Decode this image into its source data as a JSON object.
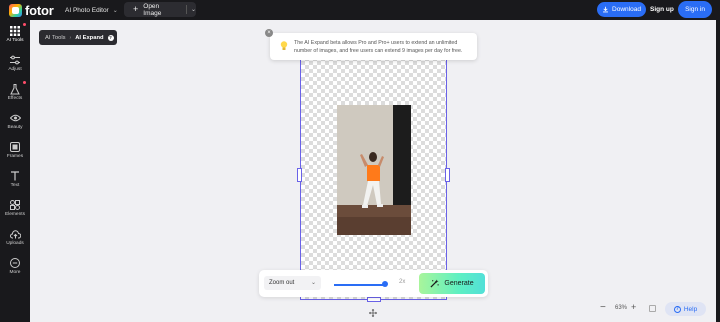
{
  "app": {
    "logo_text": "fotor",
    "editor_menu": "AI Photo Editor",
    "open_image": "Open Image",
    "download": "Download",
    "sign_up": "Sign up",
    "sign_in": "Sign in",
    "accent_color": "#2a6df5",
    "frame_color": "#6a62e8"
  },
  "sidebar": {
    "items": [
      {
        "label": "AI Tools",
        "icon": "grid-icon",
        "active": true,
        "dot": true
      },
      {
        "label": "Adjust",
        "icon": "sliders-icon",
        "active": false,
        "dot": false
      },
      {
        "label": "Effects",
        "icon": "flask-icon",
        "active": false,
        "dot": true
      },
      {
        "label": "Beauty",
        "icon": "eye-icon",
        "active": false,
        "dot": false
      },
      {
        "label": "Frames",
        "icon": "frame-icon",
        "active": false,
        "dot": false
      },
      {
        "label": "Text",
        "icon": "text-icon",
        "active": false,
        "dot": false
      },
      {
        "label": "Elements",
        "icon": "elements-icon",
        "active": false,
        "dot": false
      },
      {
        "label": "Uploads",
        "icon": "cloud-upload-icon",
        "active": false,
        "dot": false
      },
      {
        "label": "More",
        "icon": "more-icon",
        "active": false,
        "dot": false
      }
    ]
  },
  "breadcrumb": {
    "parent": "AI Tools",
    "current": "AI Expand"
  },
  "tooltip": {
    "text": "The AI Expand beta allows Pro and Pro+ users to extend an unlimited number of images, and free users can extend 9 images per day for free."
  },
  "controls": {
    "zoom_mode": "Zoom out",
    "scale_label": "2x",
    "slider_fraction": 1.0,
    "generate": "Generate"
  },
  "zoom": {
    "percent": "63%"
  },
  "help": {
    "label": "Help"
  }
}
